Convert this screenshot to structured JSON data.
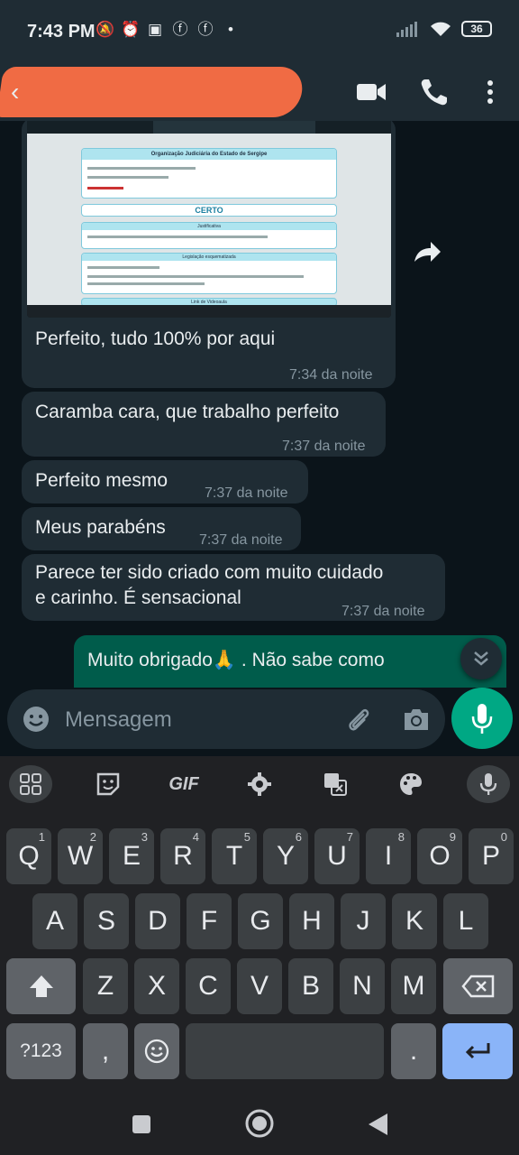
{
  "status_bar": {
    "time": "7:43 PM",
    "battery": "36"
  },
  "colors": {
    "chat_bg": "#0b141a",
    "incoming_bubble": "#1f2c34",
    "outgoing_bubble": "#005c4b",
    "accent": "#00a884",
    "enter_key": "#8ab4f8"
  },
  "messages": [
    {
      "direction": "in",
      "text": "Perfeito, tudo 100% por aqui",
      "time": "7:34 da noite",
      "has_image": true
    },
    {
      "direction": "in",
      "text": "Caramba cara, que trabalho perfeito",
      "time": "7:37 da noite"
    },
    {
      "direction": "in",
      "text": "Perfeito mesmo",
      "time": "7:37 da noite"
    },
    {
      "direction": "in",
      "text": "Meus parabéns",
      "time": "7:37 da noite"
    },
    {
      "direction": "in",
      "text_line1": "Parece ter sido criado com muito cuidado",
      "text_line2": "e carinho. É sensacional",
      "time": "7:37 da noite"
    },
    {
      "direction": "out",
      "text": "Muito obrigado🙏 . Não sabe como"
    }
  ],
  "image_preview": {
    "title": "Organização Judiciária do Estado de Sergipe",
    "verdict": "CERTO",
    "section_justification": "Justificativa",
    "section_legislation": "Legislação esquematizada",
    "section_video": "Link de Videoaula"
  },
  "input": {
    "placeholder": "Mensagem"
  },
  "keyboard": {
    "toolbar": {
      "gif": "GIF"
    },
    "row1": [
      {
        "k": "Q",
        "h": "1"
      },
      {
        "k": "W",
        "h": "2"
      },
      {
        "k": "E",
        "h": "3"
      },
      {
        "k": "R",
        "h": "4"
      },
      {
        "k": "T",
        "h": "5"
      },
      {
        "k": "Y",
        "h": "6"
      },
      {
        "k": "U",
        "h": "7"
      },
      {
        "k": "I",
        "h": "8"
      },
      {
        "k": "O",
        "h": "9"
      },
      {
        "k": "P",
        "h": "0"
      }
    ],
    "row2": [
      "A",
      "S",
      "D",
      "F",
      "G",
      "H",
      "J",
      "K",
      "L"
    ],
    "row3": [
      "Z",
      "X",
      "C",
      "V",
      "B",
      "N",
      "M"
    ],
    "row4": {
      "symbols": "?123",
      "comma": ",",
      "period": "."
    }
  }
}
